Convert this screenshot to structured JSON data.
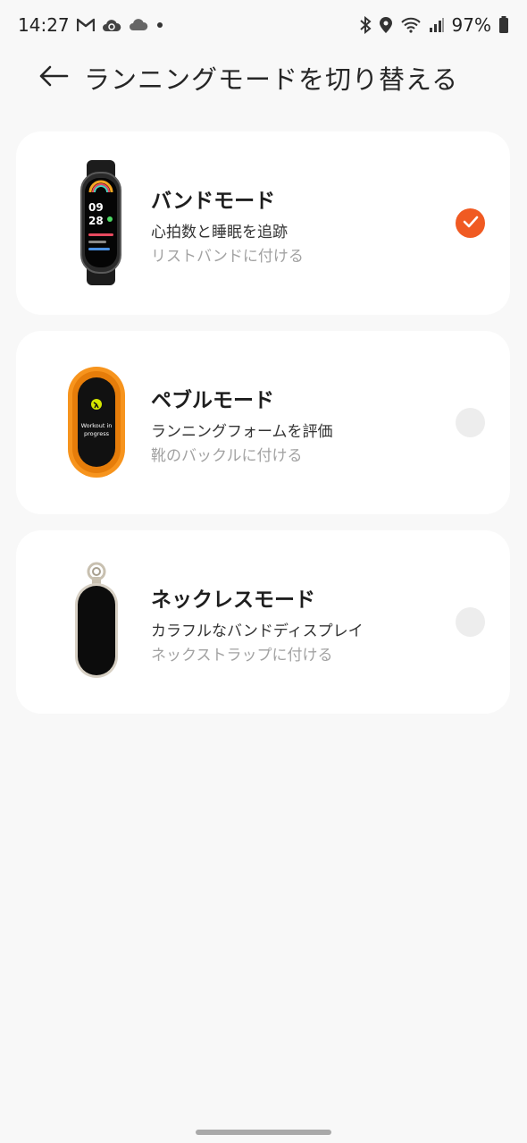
{
  "status_bar": {
    "time": "14:27",
    "battery": "97%",
    "left_icons": [
      "gmail-icon",
      "cloud-sync-icon",
      "cloud-icon",
      "dot-icon"
    ],
    "right_icons": [
      "bluetooth-icon",
      "location-icon",
      "wifi-icon",
      "signal-icon",
      "battery-icon"
    ]
  },
  "header": {
    "title": "ランニングモードを切り替える",
    "back_icon": "arrow-left-icon"
  },
  "modes": [
    {
      "title": "バンドモード",
      "description": "心拍数と睡眠を追跡",
      "subtitle": "リストバンドに付ける",
      "selected": true,
      "image": "band-device-image"
    },
    {
      "title": "ペブルモード",
      "description": "ランニングフォームを評価",
      "subtitle": "靴のバックルに付ける",
      "selected": false,
      "image": "pebble-device-image"
    },
    {
      "title": "ネックレスモード",
      "description": "カラフルなバンドディスプレイ",
      "subtitle": "ネックストラップに付ける",
      "selected": false,
      "image": "necklace-device-image"
    }
  ],
  "device_screens": {
    "band_time_hour": "09",
    "band_time_min": "28",
    "pebble_text_1": "Workout in",
    "pebble_text_2": "progress"
  },
  "colors": {
    "accent": "#f05a22",
    "background": "#f8f8f8",
    "card": "#ffffff",
    "pebble_orange": "#f7941d"
  }
}
